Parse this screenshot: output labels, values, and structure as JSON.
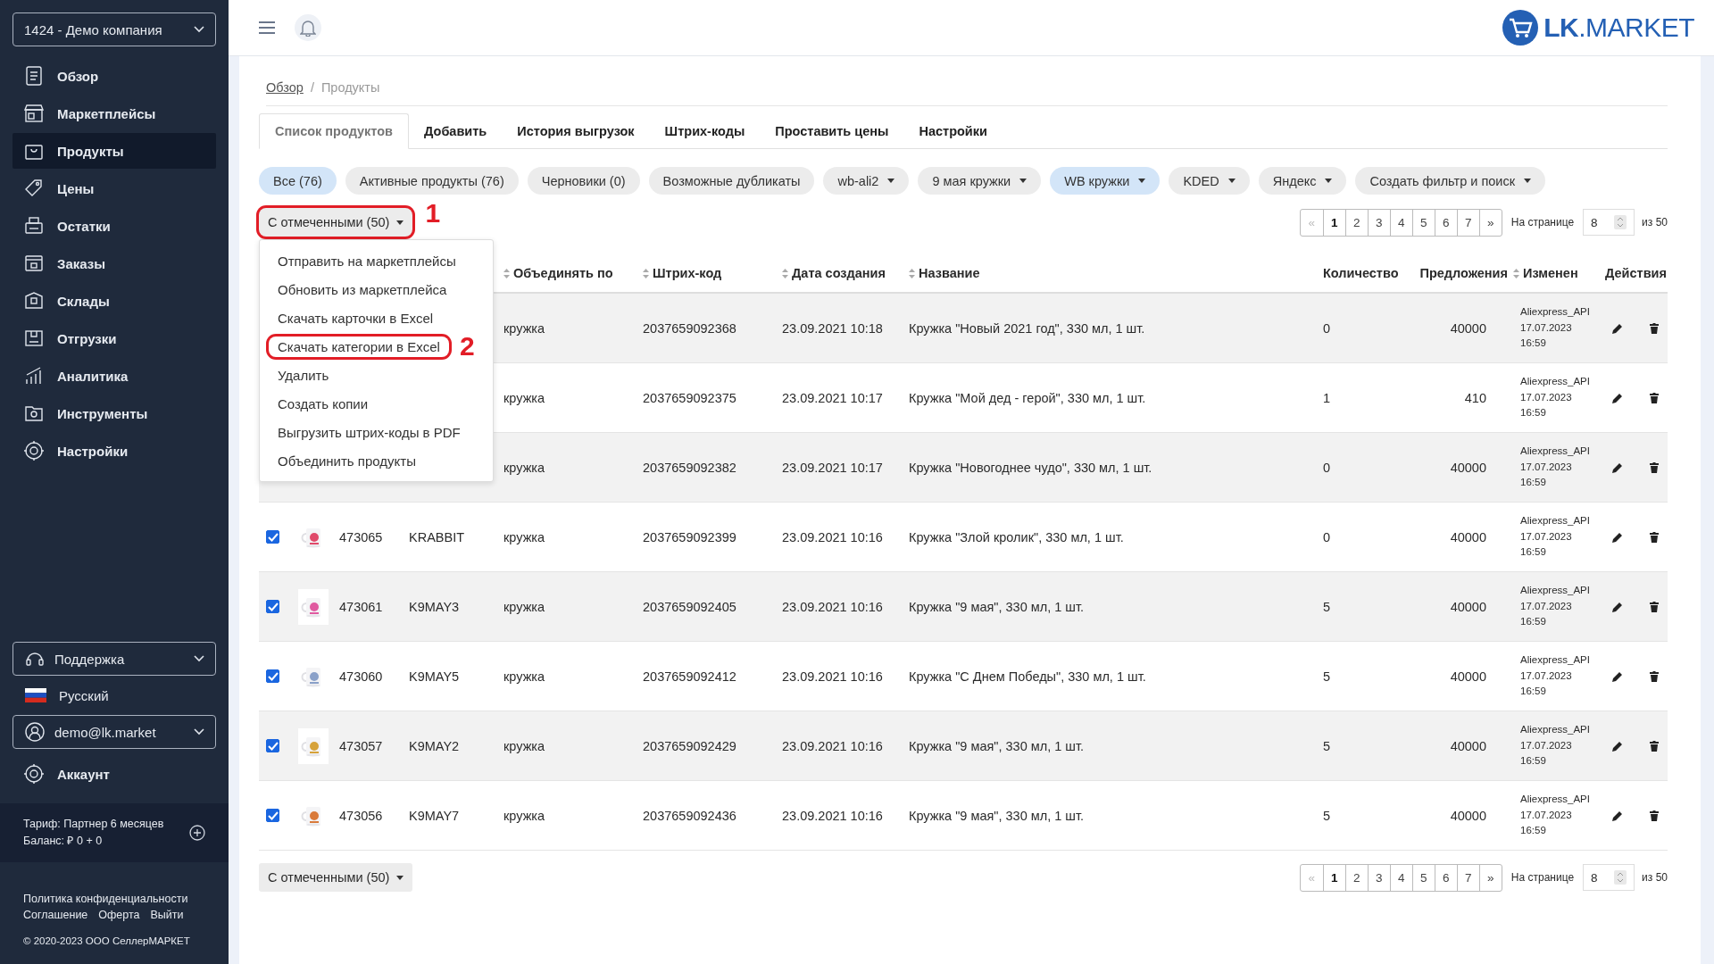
{
  "sidebar": {
    "company_select": {
      "value": "1424 - Демо компания"
    },
    "nav": [
      {
        "label": "Обзор",
        "selected": false
      },
      {
        "label": "Маркетплейсы",
        "selected": false
      },
      {
        "label": "Продукты",
        "selected": true
      },
      {
        "label": "Цены",
        "selected": false
      },
      {
        "label": "Остатки",
        "selected": false
      },
      {
        "label": "Заказы",
        "selected": false
      },
      {
        "label": "Склады",
        "selected": false
      },
      {
        "label": "Отгрузки",
        "selected": false
      },
      {
        "label": "Аналитика",
        "selected": false
      },
      {
        "label": "Инструменты",
        "selected": false
      },
      {
        "label": "Настройки",
        "selected": false
      }
    ],
    "support_select": {
      "value": "Поддержка"
    },
    "language": {
      "label": "Русский"
    },
    "user_select": {
      "value": "demo@lk.market"
    },
    "account": {
      "label": "Аккаунт"
    },
    "tariff": {
      "plan": "Тариф: Партнер 6 месяцев",
      "balance": "Баланс: ₽ 0 + 0"
    },
    "footer": {
      "privacy": "Политика конфиденциальности",
      "links": [
        "Соглашение",
        "Оферта",
        "Выйти"
      ],
      "copyright": "© 2020-2023 ООО СеллерМАРКЕТ"
    }
  },
  "header": {
    "logo": "**LK**.MARKET"
  },
  "breadcrumb": [
    {
      "label": "Обзор",
      "link": true
    },
    {
      "label": "Продукты",
      "link": false
    }
  ],
  "breadcrumb_separator": "/",
  "tabs": [
    {
      "label": "Список продуктов",
      "selected": true
    },
    {
      "label": "Добавить",
      "selected": false
    },
    {
      "label": "История выгрузок",
      "selected": false
    },
    {
      "label": "Штрих-коды",
      "selected": false
    },
    {
      "label": "Проставить цены",
      "selected": false
    },
    {
      "label": "Настройки",
      "selected": false
    }
  ],
  "filters": [
    {
      "label": "Все (76)",
      "selected": true,
      "dropdown": false
    },
    {
      "label": "Активные продукты (76)",
      "selected": false,
      "dropdown": false
    },
    {
      "label": "Черновики (0)",
      "selected": false,
      "dropdown": false
    },
    {
      "label": "Возможные дубликаты",
      "selected": false,
      "dropdown": false
    },
    {
      "label": "wb-ali2",
      "selected": false,
      "dropdown": true
    },
    {
      "label": "9 мая кружки",
      "selected": false,
      "dropdown": true
    },
    {
      "label": "WB кружки",
      "selected": true,
      "dropdown": true
    },
    {
      "label": "KDED",
      "selected": false,
      "dropdown": true
    },
    {
      "label": "Яндекс",
      "selected": false,
      "dropdown": true
    },
    {
      "label": "Создать фильтр и поиск",
      "selected": false,
      "dropdown": true
    }
  ],
  "bulk_button": {
    "label": "С отмеченными (50)",
    "annotation": "1"
  },
  "bulk_menu": [
    {
      "label": "Отправить на маркетплейсы"
    },
    {
      "label": "Обновить из маркетплейса"
    },
    {
      "label": "Скачать карточки в Excel"
    },
    {
      "label": "Скачать категории в Excel",
      "annotation": "2"
    },
    {
      "label": "Удалить"
    },
    {
      "label": "Создать копии"
    },
    {
      "label": "Выгрузить штрих-коды в PDF"
    },
    {
      "label": "Объединить продукты"
    }
  ],
  "pagination": {
    "prev": {
      "label": "«",
      "disabled": true
    },
    "pages": [
      {
        "label": "1",
        "selected": true
      },
      {
        "label": "2",
        "selected": false
      },
      {
        "label": "3",
        "selected": false
      },
      {
        "label": "4",
        "selected": false
      },
      {
        "label": "5",
        "selected": false
      },
      {
        "label": "6",
        "selected": false
      },
      {
        "label": "7",
        "selected": false
      }
    ],
    "next": {
      "label": "»",
      "disabled": false
    },
    "per_page_label": "На странице",
    "per_page": "8",
    "total": "из 50"
  },
  "table": {
    "columns": [
      {
        "label": "Объединять по",
        "sortable": true
      },
      {
        "label": "Штрих-код",
        "sortable": true
      },
      {
        "label": "Дата создания",
        "sortable": true
      },
      {
        "label": "Название",
        "sortable": true
      },
      {
        "label": "Количество",
        "sortable": false
      },
      {
        "label": "Предложения",
        "sortable": false
      },
      {
        "label": "Изменен",
        "sortable": true
      },
      {
        "label": "Действия",
        "sortable": false
      }
    ],
    "rows": [
      {
        "group": "кружка",
        "barcode": "2037659092368",
        "created": "23.09.2021 10:18",
        "name": "Кружка \"Новый 2021 год\", 330 мл, 1 шт.",
        "quantity": "0",
        "offers": "40000",
        "changed": [
          "Aliexpress_API",
          "17.07.2023",
          "16:59"
        ]
      },
      {
        "group": "кружка",
        "barcode": "2037659092375",
        "created": "23.09.2021 10:17",
        "name": "Кружка \"Мой дед - герой\", 330 мл, 1 шт.",
        "quantity": "1",
        "offers": "410",
        "changed": [
          "Aliexpress_API",
          "17.07.2023",
          "16:59"
        ]
      },
      {
        "group": "кружка",
        "barcode": "2037659092382",
        "created": "23.09.2021 10:17",
        "name": "Кружка \"Новогоднее чудо\", 330 мл, 1 шт.",
        "quantity": "0",
        "offers": "40000",
        "changed": [
          "Aliexpress_API",
          "17.07.2023",
          "16:59"
        ]
      },
      {
        "checked": true,
        "id": "473065",
        "article": "KRABBIT",
        "group": "кружка",
        "barcode": "2037659092399",
        "created": "23.09.2021 10:16",
        "name": "Кружка \"Злой кролик\", 330 мл, 1 шт.",
        "quantity": "0",
        "offers": "40000",
        "changed": [
          "Aliexpress_API",
          "17.07.2023",
          "16:59"
        ]
      },
      {
        "checked": true,
        "id": "473061",
        "article": "K9MAY3",
        "group": "кружка",
        "barcode": "2037659092405",
        "created": "23.09.2021 10:16",
        "name": "Кружка \"9 мая\", 330 мл, 1 шт.",
        "quantity": "5",
        "offers": "40000",
        "changed": [
          "Aliexpress_API",
          "17.07.2023",
          "16:59"
        ]
      },
      {
        "checked": true,
        "id": "473060",
        "article": "K9MAY5",
        "group": "кружка",
        "barcode": "2037659092412",
        "created": "23.09.2021 10:16",
        "name": "Кружка \"С Днем Победы\", 330 мл, 1 шт.",
        "quantity": "5",
        "offers": "40000",
        "changed": [
          "Aliexpress_API",
          "17.07.2023",
          "16:59"
        ]
      },
      {
        "checked": true,
        "id": "473057",
        "article": "K9MAY2",
        "group": "кружка",
        "barcode": "2037659092429",
        "created": "23.09.2021 10:16",
        "name": "Кружка \"9 мая\", 330 мл, 1 шт.",
        "quantity": "5",
        "offers": "40000",
        "changed": [
          "Aliexpress_API",
          "17.07.2023",
          "16:59"
        ]
      },
      {
        "checked": true,
        "id": "473056",
        "article": "K9MAY7",
        "group": "кружка",
        "barcode": "2037659092436",
        "created": "23.09.2021 10:16",
        "name": "Кружка \"9 мая\", 330 мл, 1 шт.",
        "quantity": "5",
        "offers": "40000",
        "changed": [
          "Aliexpress_API",
          "17.07.2023",
          "16:59"
        ]
      }
    ]
  },
  "bottom_bulk_button": {
    "label": "С отмеченными (50)"
  },
  "bottom_pagination": {
    "prev": {
      "label": "«",
      "disabled": true
    },
    "pages": [
      {
        "label": "1",
        "selected": true
      },
      {
        "label": "2",
        "selected": false
      },
      {
        "label": "3",
        "selected": false
      },
      {
        "label": "4",
        "selected": false
      },
      {
        "label": "5",
        "selected": false
      },
      {
        "label": "6",
        "selected": false
      },
      {
        "label": "7",
        "selected": false
      }
    ],
    "next": {
      "label": "»",
      "disabled": false
    },
    "per_page_label": "На странице",
    "per_page": "8",
    "total": "из 50"
  }
}
